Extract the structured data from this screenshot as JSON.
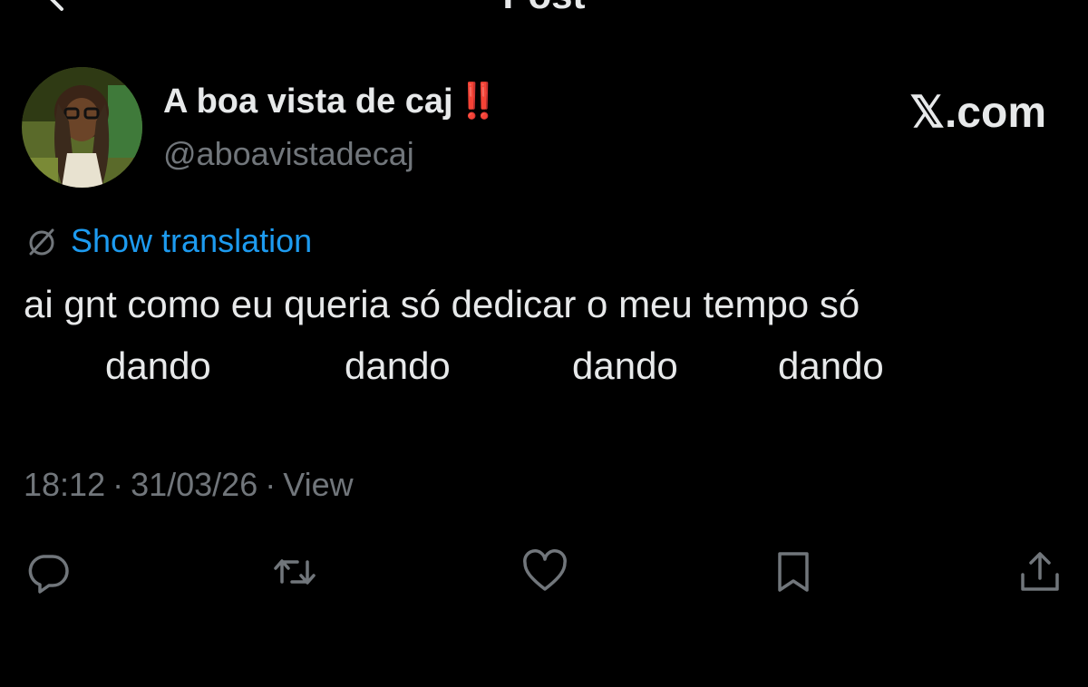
{
  "header": {
    "title": "Post",
    "back_icon": "back-arrow-icon"
  },
  "author": {
    "display_name": "A boa vista de caj",
    "name_emoji": "‼️",
    "handle": "@aboavistadecaj",
    "avatar_icon": "profile-photo"
  },
  "source_label": "𝕏.com",
  "translation": {
    "icon": "globe-slash-icon",
    "label": "Show translation",
    "color": "#1d9bf0"
  },
  "tweet": {
    "line1": "ai gnt como eu queria só dedicar o meu tempo só",
    "line2_words": [
      "dando",
      "dando",
      "dando",
      "dando"
    ]
  },
  "meta": {
    "time": "18:12",
    "date": "31/03/26",
    "views": "View",
    "separator": "·"
  },
  "actions": [
    {
      "name": "reply",
      "icon": "reply-icon"
    },
    {
      "name": "repost",
      "icon": "repost-icon"
    },
    {
      "name": "like",
      "icon": "heart-icon"
    },
    {
      "name": "bookmark",
      "icon": "bookmark-icon"
    },
    {
      "name": "share",
      "icon": "share-icon"
    }
  ],
  "colors": {
    "background": "#000000",
    "text": "#e7e9ea",
    "muted": "#71767b",
    "accent": "#1d9bf0",
    "emoji_red": "#e0162b"
  }
}
